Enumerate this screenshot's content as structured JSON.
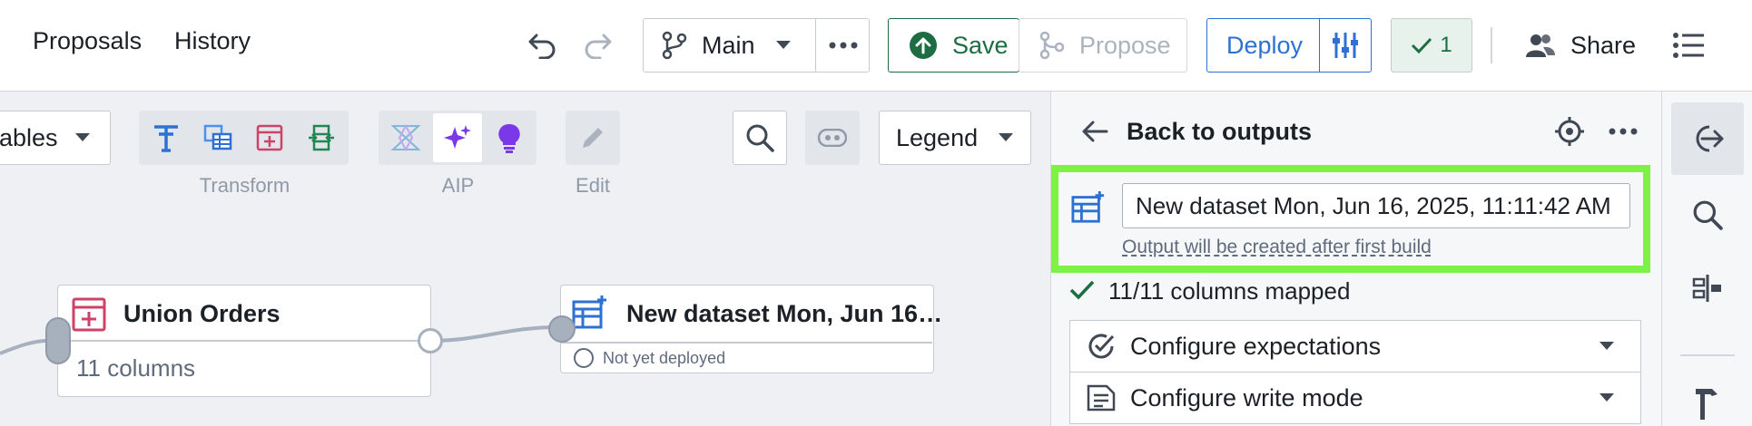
{
  "header": {
    "nav": [
      "Proposals",
      "History"
    ],
    "branch_label": "Main",
    "save_label": "Save",
    "propose_label": "Propose",
    "deploy_label": "Deploy",
    "checks_count": "1",
    "share_label": "Share"
  },
  "canvas_toolbar": {
    "variables_label": "ables",
    "transform_label": "Transform",
    "aip_label": "AIP",
    "edit_label": "Edit",
    "legend_label": "Legend"
  },
  "graph": {
    "union_node": {
      "title": "Union Orders",
      "subtitle": "11 columns"
    },
    "dataset_node": {
      "title": "New dataset Mon, Jun 16…",
      "status": "Not yet deployed"
    }
  },
  "panel": {
    "back_label": "Back to outputs",
    "dataset_name": "New dataset Mon, Jun 16, 2025, 11:11:42 AM",
    "output_note": "Output will be created after first build",
    "columns_mapped": "11/11 columns mapped",
    "configure_expectations": "Configure expectations",
    "configure_write_mode": "Configure write mode"
  },
  "colors": {
    "save_green": "#1c6e42",
    "deploy_blue": "#2d72d2",
    "highlight": "#7cf244",
    "transform_blue": "#2d72d2",
    "union_pink": "#cd4266",
    "join_green": "#238551",
    "aip_purple": "#7a38e8"
  }
}
